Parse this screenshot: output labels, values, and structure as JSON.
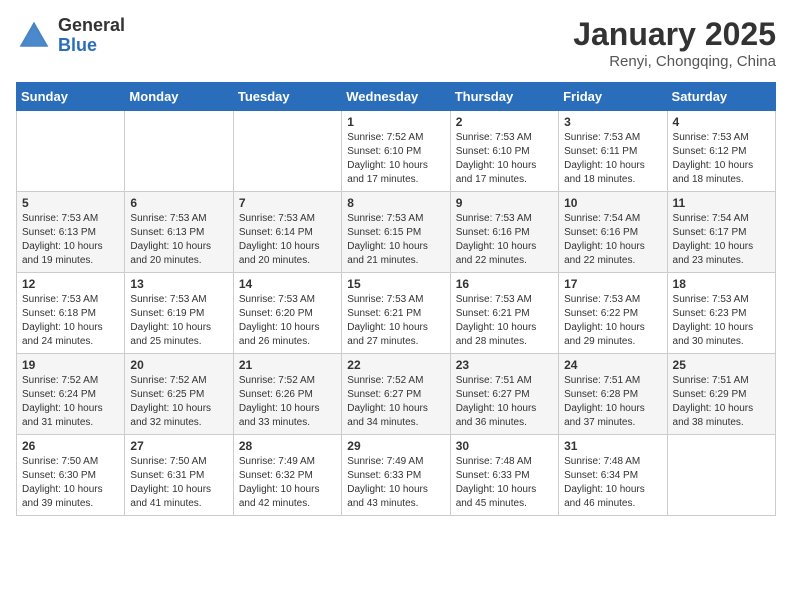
{
  "header": {
    "logo_general": "General",
    "logo_blue": "Blue",
    "month": "January 2025",
    "location": "Renyi, Chongqing, China"
  },
  "days_of_week": [
    "Sunday",
    "Monday",
    "Tuesday",
    "Wednesday",
    "Thursday",
    "Friday",
    "Saturday"
  ],
  "weeks": [
    [
      {
        "day": "",
        "info": ""
      },
      {
        "day": "",
        "info": ""
      },
      {
        "day": "",
        "info": ""
      },
      {
        "day": "1",
        "info": "Sunrise: 7:52 AM\nSunset: 6:10 PM\nDaylight: 10 hours\nand 17 minutes."
      },
      {
        "day": "2",
        "info": "Sunrise: 7:53 AM\nSunset: 6:10 PM\nDaylight: 10 hours\nand 17 minutes."
      },
      {
        "day": "3",
        "info": "Sunrise: 7:53 AM\nSunset: 6:11 PM\nDaylight: 10 hours\nand 18 minutes."
      },
      {
        "day": "4",
        "info": "Sunrise: 7:53 AM\nSunset: 6:12 PM\nDaylight: 10 hours\nand 18 minutes."
      }
    ],
    [
      {
        "day": "5",
        "info": "Sunrise: 7:53 AM\nSunset: 6:13 PM\nDaylight: 10 hours\nand 19 minutes."
      },
      {
        "day": "6",
        "info": "Sunrise: 7:53 AM\nSunset: 6:13 PM\nDaylight: 10 hours\nand 20 minutes."
      },
      {
        "day": "7",
        "info": "Sunrise: 7:53 AM\nSunset: 6:14 PM\nDaylight: 10 hours\nand 20 minutes."
      },
      {
        "day": "8",
        "info": "Sunrise: 7:53 AM\nSunset: 6:15 PM\nDaylight: 10 hours\nand 21 minutes."
      },
      {
        "day": "9",
        "info": "Sunrise: 7:53 AM\nSunset: 6:16 PM\nDaylight: 10 hours\nand 22 minutes."
      },
      {
        "day": "10",
        "info": "Sunrise: 7:54 AM\nSunset: 6:16 PM\nDaylight: 10 hours\nand 22 minutes."
      },
      {
        "day": "11",
        "info": "Sunrise: 7:54 AM\nSunset: 6:17 PM\nDaylight: 10 hours\nand 23 minutes."
      }
    ],
    [
      {
        "day": "12",
        "info": "Sunrise: 7:53 AM\nSunset: 6:18 PM\nDaylight: 10 hours\nand 24 minutes."
      },
      {
        "day": "13",
        "info": "Sunrise: 7:53 AM\nSunset: 6:19 PM\nDaylight: 10 hours\nand 25 minutes."
      },
      {
        "day": "14",
        "info": "Sunrise: 7:53 AM\nSunset: 6:20 PM\nDaylight: 10 hours\nand 26 minutes."
      },
      {
        "day": "15",
        "info": "Sunrise: 7:53 AM\nSunset: 6:21 PM\nDaylight: 10 hours\nand 27 minutes."
      },
      {
        "day": "16",
        "info": "Sunrise: 7:53 AM\nSunset: 6:21 PM\nDaylight: 10 hours\nand 28 minutes."
      },
      {
        "day": "17",
        "info": "Sunrise: 7:53 AM\nSunset: 6:22 PM\nDaylight: 10 hours\nand 29 minutes."
      },
      {
        "day": "18",
        "info": "Sunrise: 7:53 AM\nSunset: 6:23 PM\nDaylight: 10 hours\nand 30 minutes."
      }
    ],
    [
      {
        "day": "19",
        "info": "Sunrise: 7:52 AM\nSunset: 6:24 PM\nDaylight: 10 hours\nand 31 minutes."
      },
      {
        "day": "20",
        "info": "Sunrise: 7:52 AM\nSunset: 6:25 PM\nDaylight: 10 hours\nand 32 minutes."
      },
      {
        "day": "21",
        "info": "Sunrise: 7:52 AM\nSunset: 6:26 PM\nDaylight: 10 hours\nand 33 minutes."
      },
      {
        "day": "22",
        "info": "Sunrise: 7:52 AM\nSunset: 6:27 PM\nDaylight: 10 hours\nand 34 minutes."
      },
      {
        "day": "23",
        "info": "Sunrise: 7:51 AM\nSunset: 6:27 PM\nDaylight: 10 hours\nand 36 minutes."
      },
      {
        "day": "24",
        "info": "Sunrise: 7:51 AM\nSunset: 6:28 PM\nDaylight: 10 hours\nand 37 minutes."
      },
      {
        "day": "25",
        "info": "Sunrise: 7:51 AM\nSunset: 6:29 PM\nDaylight: 10 hours\nand 38 minutes."
      }
    ],
    [
      {
        "day": "26",
        "info": "Sunrise: 7:50 AM\nSunset: 6:30 PM\nDaylight: 10 hours\nand 39 minutes."
      },
      {
        "day": "27",
        "info": "Sunrise: 7:50 AM\nSunset: 6:31 PM\nDaylight: 10 hours\nand 41 minutes."
      },
      {
        "day": "28",
        "info": "Sunrise: 7:49 AM\nSunset: 6:32 PM\nDaylight: 10 hours\nand 42 minutes."
      },
      {
        "day": "29",
        "info": "Sunrise: 7:49 AM\nSunset: 6:33 PM\nDaylight: 10 hours\nand 43 minutes."
      },
      {
        "day": "30",
        "info": "Sunrise: 7:48 AM\nSunset: 6:33 PM\nDaylight: 10 hours\nand 45 minutes."
      },
      {
        "day": "31",
        "info": "Sunrise: 7:48 AM\nSunset: 6:34 PM\nDaylight: 10 hours\nand 46 minutes."
      },
      {
        "day": "",
        "info": ""
      }
    ]
  ]
}
